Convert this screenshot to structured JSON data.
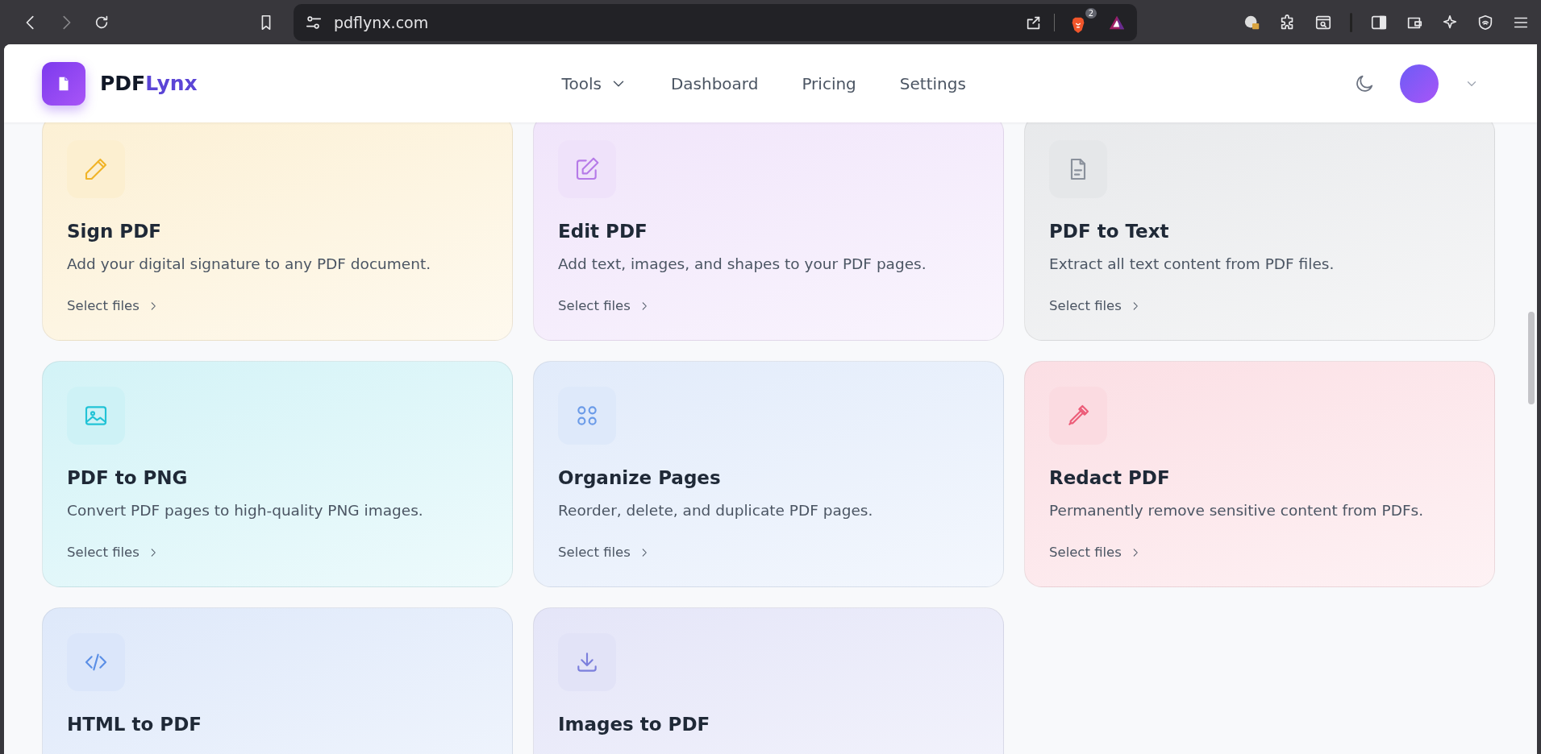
{
  "browser": {
    "url": "pdflynx.com",
    "shields_badge": "2"
  },
  "header": {
    "brand_first": "PDF",
    "brand_second": "Lynx",
    "nav": [
      {
        "label": "Tools",
        "kind": "dropdown"
      },
      {
        "label": "Dashboard",
        "kind": "link"
      },
      {
        "label": "Pricing",
        "kind": "link"
      },
      {
        "label": "Settings",
        "kind": "link"
      }
    ]
  },
  "tools": [
    {
      "title": "Sign PDF",
      "description": "Add your digital signature to any PDF document.",
      "action": "Select files",
      "kind": "pencil",
      "color": "#f0b429"
    },
    {
      "title": "Edit PDF",
      "description": "Add text, images, and shapes to your PDF pages.",
      "action": "Select files",
      "kind": "edit",
      "color": "#b67be8"
    },
    {
      "title": "PDF to Text",
      "description": "Extract all text content from PDF files.",
      "action": "Select files",
      "kind": "document",
      "color": "#8a919c"
    },
    {
      "title": "PDF to PNG",
      "description": "Convert PDF pages to high-quality PNG images.",
      "action": "Select files",
      "kind": "image",
      "color": "#22c3d6"
    },
    {
      "title": "Organize Pages",
      "description": "Reorder, delete, and duplicate PDF pages.",
      "action": "Select files",
      "kind": "grid",
      "color": "#6b9be8"
    },
    {
      "title": "Redact PDF",
      "description": "Permanently remove sensitive content from PDFs.",
      "action": "Select files",
      "kind": "dropper",
      "color": "#ec5c78"
    },
    {
      "title": "HTML to PDF",
      "kind": "code",
      "color": "#5b8fe6"
    },
    {
      "title": "Images to PDF",
      "kind": "download",
      "color": "#7b7fdc"
    }
  ]
}
